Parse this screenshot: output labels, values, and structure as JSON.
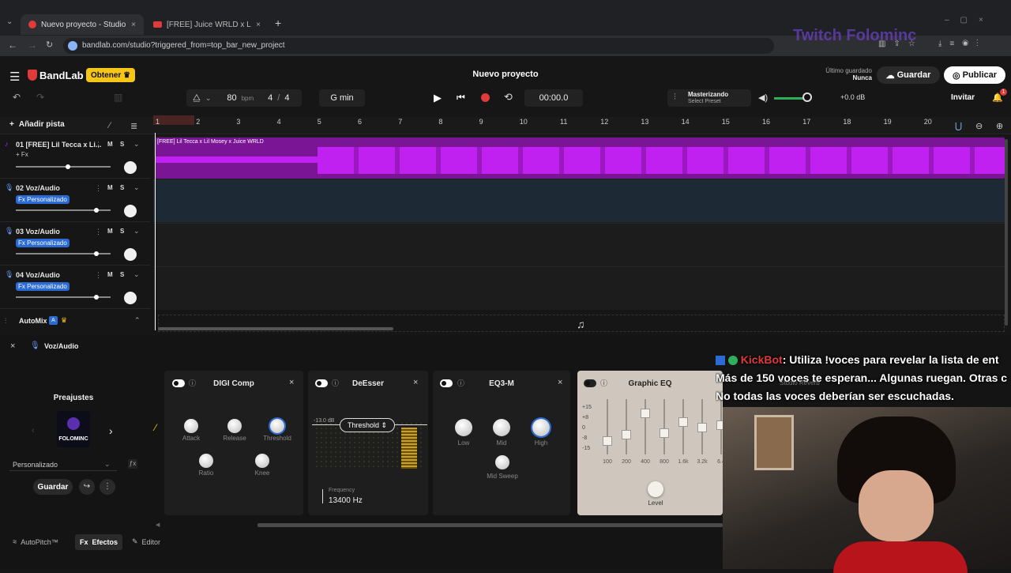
{
  "browser": {
    "tabs": [
      {
        "title": "Nuevo proyecto - Studio",
        "active": true
      },
      {
        "title": "[FREE] Juice WRLD x Lil Tecca T",
        "active": false
      }
    ],
    "url": "bandlab.com/studio?triggered_from=top_bar_new_project"
  },
  "header": {
    "brand": "BandLab",
    "get_label": "Obtener",
    "project_title": "Nuevo proyecto",
    "last_saved_label": "Último guardado",
    "last_saved_value": "Nunca",
    "save_label": "Guardar",
    "publish_label": "Publicar",
    "invite_label": "Invitar",
    "notification_count": "1",
    "watermark": "Twitch Folominc"
  },
  "transport": {
    "bpm_value": "80",
    "bpm_unit": "bpm",
    "time_sig_num": "4",
    "time_sig_sep": "/",
    "time_sig_den": "4",
    "key": "G min",
    "time": "00:00.0",
    "mastering_title": "Masterizando",
    "mastering_preset": "Select Preset",
    "master_db": "+0.0 dB"
  },
  "toolbar": {
    "add_track_label": "Añadir pista"
  },
  "ruler": [
    "1",
    "2",
    "3",
    "4",
    "5",
    "6",
    "7",
    "8",
    "9",
    "10",
    "11",
    "12",
    "13",
    "14",
    "15",
    "16",
    "17",
    "18",
    "19",
    "20"
  ],
  "tracks": [
    {
      "name": "01 [FREE] Lil Tecca x Li...",
      "fx": "+ Fx",
      "fx_custom": false,
      "vol": 0.55
    },
    {
      "name": "02 Voz/Audio",
      "fx": "Fx Personalizado",
      "fx_custom": true,
      "vol": 0.85
    },
    {
      "name": "03 Voz/Audio",
      "fx": "Fx Personalizado",
      "fx_custom": true,
      "vol": 0.85
    },
    {
      "name": "04 Voz/Audio",
      "fx": "Fx Personalizado",
      "fx_custom": true,
      "vol": 0.85
    }
  ],
  "clip": {
    "label": "[FREE] Lil Tecca x Lil Mosey x Juice WRLD"
  },
  "automix": {
    "label": "AutoMix"
  },
  "fx_panel": {
    "track_label": "Voz/Audio",
    "presets_label": "Preajustes",
    "preset_name": "FOLOMINC",
    "preset_select": "Personalizado",
    "save_label": "Guardar",
    "bottom_tabs": [
      "AutoPitch™",
      "Efectos",
      "Editor"
    ]
  },
  "effects": {
    "digicomp": {
      "title": "DIGI Comp",
      "knobs": [
        "Attack",
        "Release",
        "Threshold",
        "Ratio",
        "Knee"
      ]
    },
    "deesser": {
      "title": "DeEsser",
      "db": "-13.0 dB",
      "mode": "Threshold",
      "freq_label": "Frequency",
      "freq_value": "13400 Hz"
    },
    "eq3": {
      "title": "EQ3-M",
      "knobs": [
        "Low",
        "Mid",
        "High",
        "Mid Sweep"
      ]
    },
    "geq": {
      "title": "Graphic EQ",
      "scale": [
        "+15",
        "+8",
        "0",
        "-8",
        "-15"
      ],
      "bands": [
        "100",
        "200",
        "400",
        "800",
        "1.6k",
        "3.2k",
        "6.4"
      ],
      "level_label": "Level"
    }
  },
  "chat": {
    "user": "KickBot",
    "lines": [
      ": Utiliza !voces para revelar la lista de ent",
      "Más de 150 voces te esperan... Algunas ruegan. Otras c",
      "No todas las voces deberían ser escuchadas."
    ],
    "overlay_hint": "Studio Reverb"
  },
  "colors": {
    "accent": "#e03a3a",
    "waveform": "#c020f0",
    "get_button": "#f5c518",
    "badge": "#2a6bd6"
  }
}
